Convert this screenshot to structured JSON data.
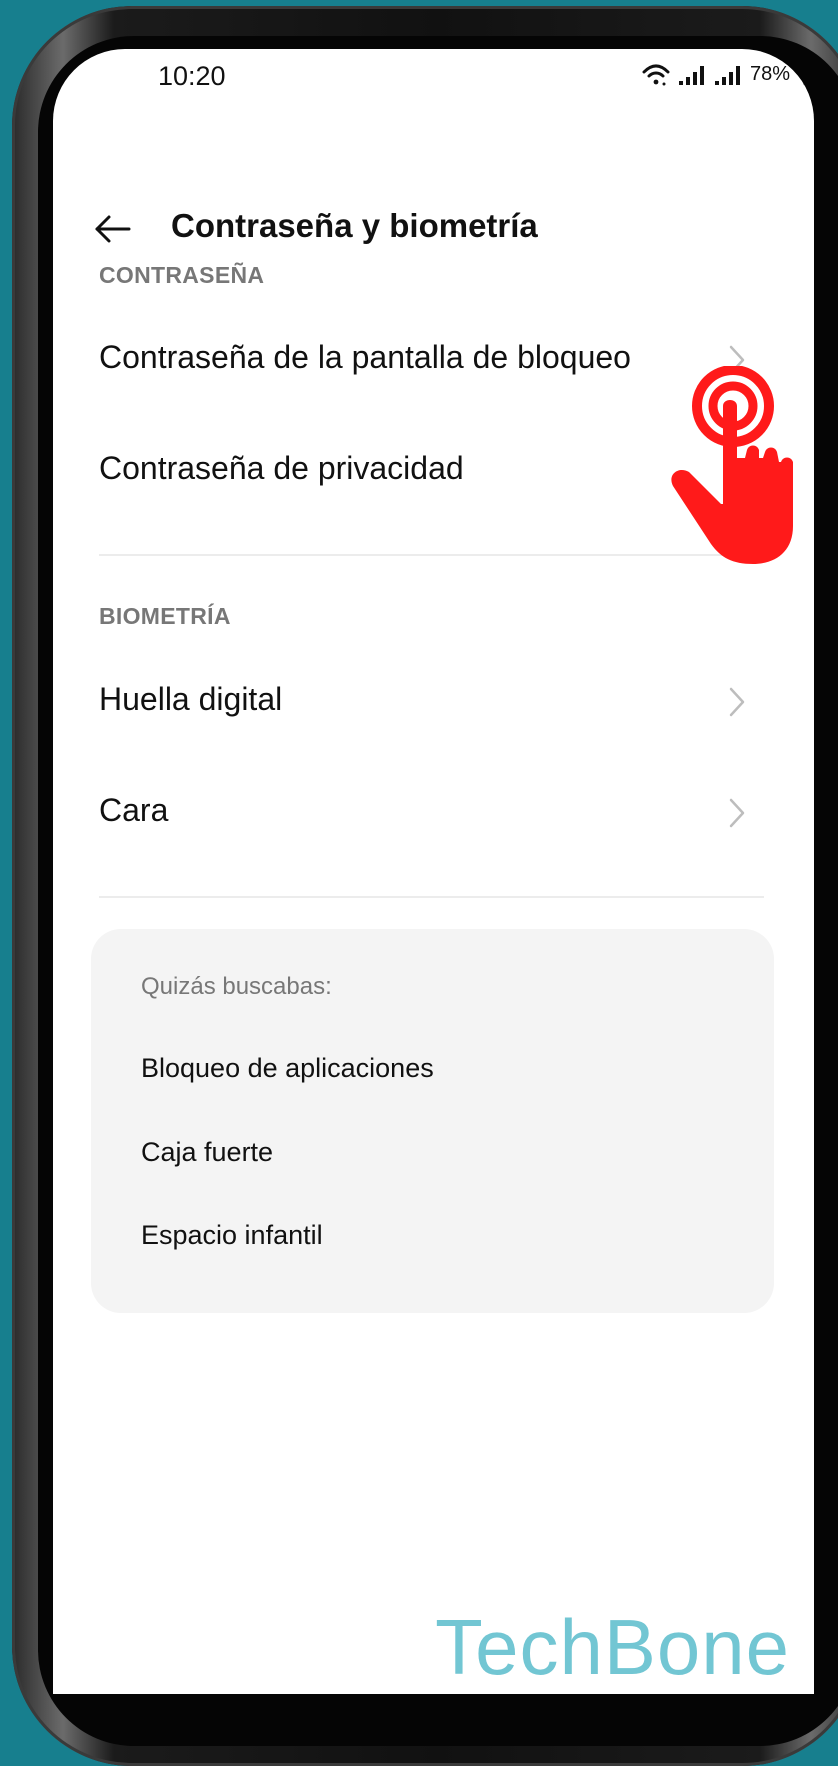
{
  "status_bar": {
    "time": "10:20",
    "battery": "78%"
  },
  "header": {
    "title": "Contraseña y biometría"
  },
  "sections": [
    {
      "title": "CONTRASEÑA",
      "items": [
        {
          "label": "Contraseña de la pantalla de bloqueo"
        },
        {
          "label": "Contraseña de privacidad"
        }
      ]
    },
    {
      "title": "BIOMETRÍA",
      "items": [
        {
          "label": "Huella digital"
        },
        {
          "label": "Cara"
        }
      ]
    }
  ],
  "suggestions": {
    "title": "Quizás buscabas:",
    "items": [
      {
        "label": "Bloqueo de aplicaciones"
      },
      {
        "label": "Caja fuerte"
      },
      {
        "label": "Espacio infantil"
      }
    ]
  },
  "watermark": "TechBone",
  "colors": {
    "background": "#177f8e",
    "tap_indicator": "#ff1a1a",
    "watermark": "#72c6d3"
  },
  "icons": {
    "back": "arrow-left-icon",
    "chevron": "chevron-right-icon",
    "tap": "tap-hand-icon"
  }
}
